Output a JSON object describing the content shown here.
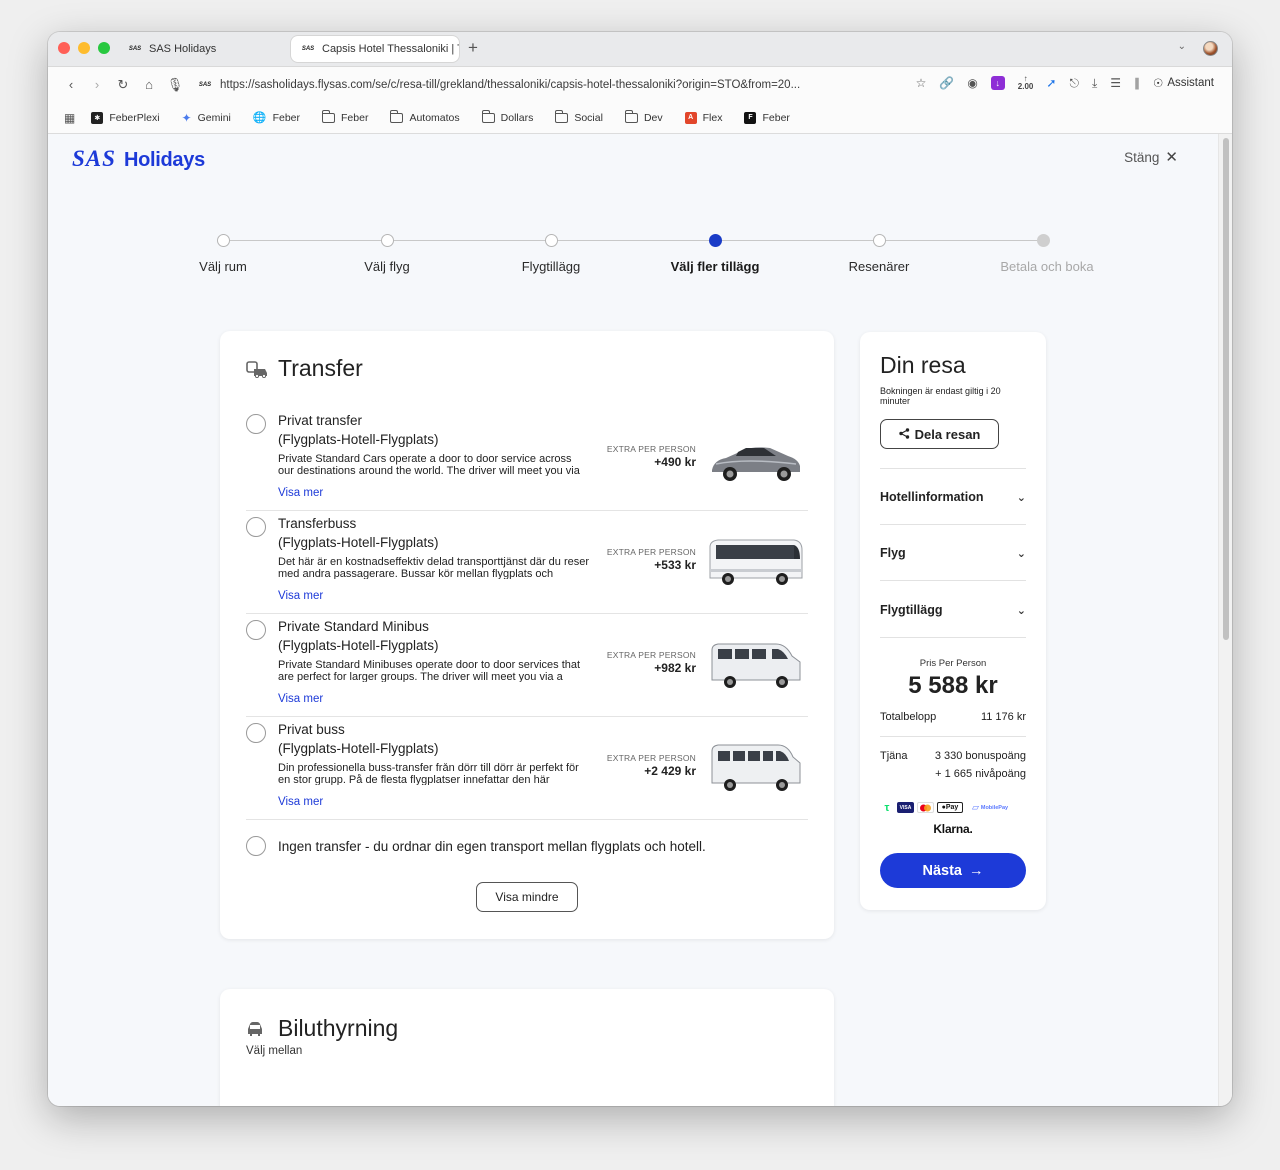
{
  "browser": {
    "tabs": [
      {
        "title": "SAS Holidays",
        "favicon": "SAS"
      },
      {
        "title": "Capsis Hotel Thessaloniki | T",
        "favicon": "SAS"
      }
    ],
    "url": "https://sasholidays.flysas.com/se/c/resa-till/grekland/thessaloniki/capsis-hotel-thessaloniki?origin=STO&from=20...",
    "zoom": "2.00",
    "assistant": "Assistant",
    "bookmarks": [
      "FeberPlexi",
      "Gemini",
      "Feber",
      "Feber",
      "Automatos",
      "Dollars",
      "Social",
      "Dev",
      "Flex",
      "Feber"
    ]
  },
  "header": {
    "logo_sas": "SAS",
    "logo_holidays": "Holidays",
    "close_label": "Stäng"
  },
  "stepper": {
    "steps": [
      "Välj rum",
      "Välj flyg",
      "Flygtillägg",
      "Välj fler tillägg",
      "Resenärer",
      "Betala och boka"
    ],
    "active_index": 3
  },
  "transfer": {
    "title": "Transfer",
    "options": [
      {
        "name": "Privat transfer",
        "route": "(Flygplats-Hotell-Flygplats)",
        "description": "Private Standard Cars operate a door to door service across our destinations around the world. The driver will meet you via",
        "more": "Visa mer",
        "price_label": "EXTRA PER PERSON",
        "price": "+490 kr"
      },
      {
        "name": "Transferbuss",
        "route": "(Flygplats-Hotell-Flygplats)",
        "description": "Det här är en kostnadseffektiv delad transporttjänst där du reser med andra passagerare. Bussar kör mellan flygplats och",
        "more": "Visa mer",
        "price_label": "EXTRA PER PERSON",
        "price": "+533 kr"
      },
      {
        "name": "Private Standard Minibus",
        "route": "(Flygplats-Hotell-Flygplats)",
        "description": "Private Standard Minibuses operate door to door services that are perfect for larger groups. The driver will meet you via a",
        "more": "Visa mer",
        "price_label": "EXTRA PER PERSON",
        "price": "+982 kr"
      },
      {
        "name": "Privat buss",
        "route": "(Flygplats-Hotell-Flygplats)",
        "description": "Din professionella buss-transfer från dörr till dörr är perfekt för en stor grupp. På de flesta flygplatser innefattar den här",
        "more": "Visa mer",
        "price_label": "EXTRA PER PERSON",
        "price": "+2 429 kr"
      }
    ],
    "no_transfer": "Ingen transfer - du ordnar din egen transport mellan flygplats och hotell.",
    "show_less": "Visa mindre"
  },
  "rental": {
    "title": "Biluthyrning",
    "subtitle": "Välj mellan"
  },
  "summary": {
    "title": "Din resa",
    "note": "Bokningen är endast giltig i 20 minuter",
    "share": "Dela resan",
    "sections": [
      "Hotellinformation",
      "Flyg",
      "Flygtillägg"
    ],
    "price_per_person_label": "Pris Per Person",
    "price_per_person": "5 588 kr",
    "total_label": "Totalbelopp",
    "total": "11 176 kr",
    "earn_label": "Tjäna",
    "bonus_points": "3 330 bonuspoäng",
    "level_points": "+ 1 665 nivåpoäng",
    "payment_icons": [
      "trustly-icon",
      "visa-icon",
      "mastercard-icon",
      "applepay-icon",
      "mobilepay-icon"
    ],
    "applepay": "Pay",
    "mobilepay": "MobilePay",
    "klarna": "Klarna.",
    "next": "Nästa"
  },
  "colors": {
    "brand_blue": "#1d3ad8",
    "step_active": "#1a3cc7"
  }
}
